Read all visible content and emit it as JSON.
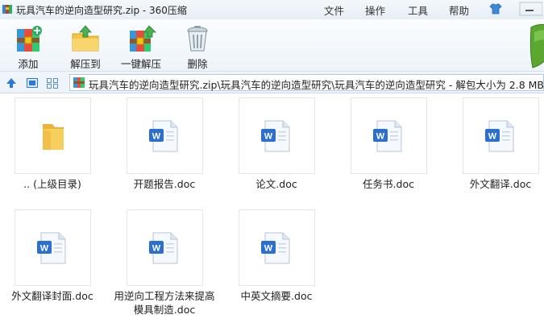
{
  "window": {
    "title": "玩具汽车的逆向造型研究.zip - 360压缩"
  },
  "menu": [
    "文件",
    "操作",
    "工具",
    "帮助"
  ],
  "toolbar": {
    "add": "添加",
    "extract_to": "解压到",
    "one_click_extract": "一键解压",
    "delete": "删除"
  },
  "addressbar": {
    "path": "玩具汽车的逆向造型研究.zip\\玩具汽车的逆向造型研究\\玩具汽车的逆向造型研究 - 解包大小为 2.8 MB"
  },
  "files": [
    {
      "name": ".. (上级目录)",
      "icon": "folder-icon"
    },
    {
      "name": "开题报告.doc",
      "icon": "word-doc-icon"
    },
    {
      "name": "论文.doc",
      "icon": "word-doc-icon"
    },
    {
      "name": "任务书.doc",
      "icon": "word-doc-icon"
    },
    {
      "name": "外文翻译.doc",
      "icon": "word-doc-icon"
    },
    {
      "name": "外文翻译封面.doc",
      "icon": "word-doc-icon"
    },
    {
      "name": "用逆向工程方法来提高模具制造.doc",
      "icon": "word-doc-icon"
    },
    {
      "name": "中英文摘要.doc",
      "icon": "word-doc-icon"
    }
  ],
  "colors": {
    "accent": "#2b7bd6",
    "shield_green": "#5aa832",
    "folder": "#f4c544",
    "word_blue": "#2b6fd1"
  }
}
